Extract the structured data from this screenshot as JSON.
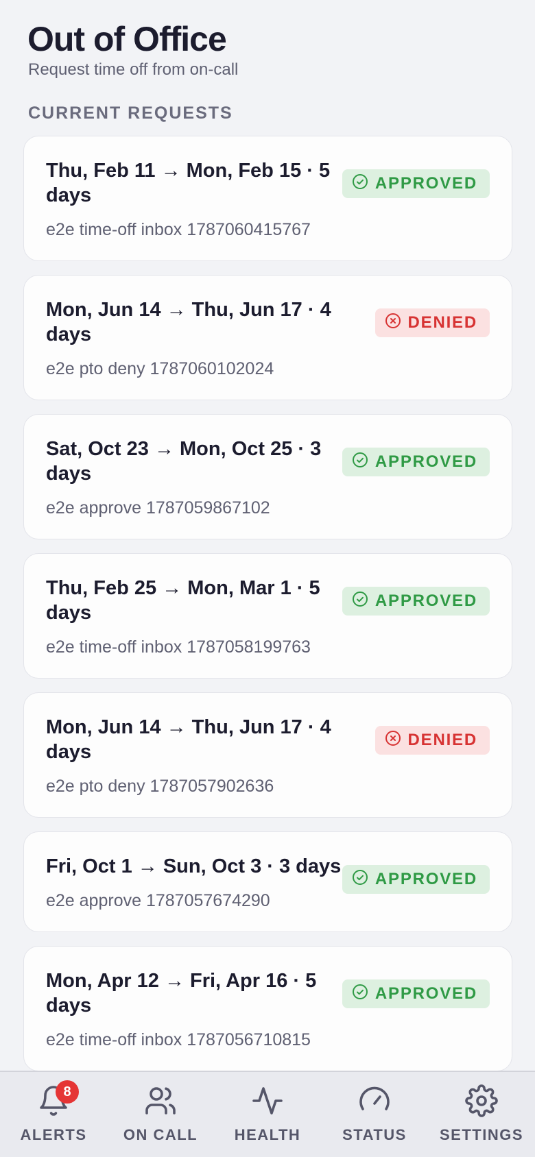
{
  "header": {
    "title": "Out of Office",
    "subtitle": "Request time off from on-call"
  },
  "section_label": "CURRENT REQUESTS",
  "requests": [
    {
      "title": "Thu, Feb 11 → Mon, Feb 15 · 5 days",
      "note": "e2e time-off inbox 1787060415767",
      "status": "APPROVED",
      "kind": "approved"
    },
    {
      "title": "Mon, Jun 14 → Thu, Jun 17 · 4 days",
      "note": "e2e pto deny 1787060102024",
      "status": "DENIED",
      "kind": "denied"
    },
    {
      "title": "Sat, Oct 23 → Mon, Oct 25 · 3 days",
      "note": "e2e approve 1787059867102",
      "status": "APPROVED",
      "kind": "approved"
    },
    {
      "title": "Thu, Feb 25 → Mon, Mar 1 · 5 days",
      "note": "e2e time-off inbox 1787058199763",
      "status": "APPROVED",
      "kind": "approved"
    },
    {
      "title": "Mon, Jun 14 → Thu, Jun 17 · 4 days",
      "note": "e2e pto deny 1787057902636",
      "status": "DENIED",
      "kind": "denied"
    },
    {
      "title": "Fri, Oct 1 → Sun, Oct 3 · 3 days",
      "note": "e2e approve 1787057674290",
      "status": "APPROVED",
      "kind": "approved"
    },
    {
      "title": "Mon, Apr 12 → Fri, Apr 16 · 5 days",
      "note": "e2e time-off inbox 1787056710815",
      "status": "APPROVED",
      "kind": "approved"
    }
  ],
  "tabs": [
    {
      "label": "ALERTS",
      "icon": "bell-icon",
      "badge": "8"
    },
    {
      "label": "ON CALL",
      "icon": "users-icon"
    },
    {
      "label": "HEALTH",
      "icon": "activity-icon"
    },
    {
      "label": "STATUS",
      "icon": "gauge-icon"
    },
    {
      "label": "SETTINGS",
      "icon": "gear-icon"
    }
  ],
  "colors": {
    "approved": "#2f9a45",
    "denied": "#d73333",
    "badge_alert": "#e53535"
  }
}
